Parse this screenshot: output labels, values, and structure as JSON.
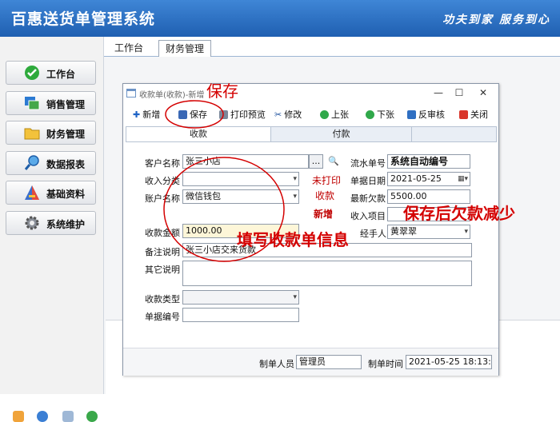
{
  "app": {
    "title": "百惠送货单管理系统",
    "slogan": "功夫到家 服务到心"
  },
  "sidebar": {
    "items": [
      {
        "label": "工作台",
        "icon": "check-circle-icon"
      },
      {
        "label": "销售管理",
        "icon": "window-stack-icon"
      },
      {
        "label": "财务管理",
        "icon": "folder-icon"
      },
      {
        "label": "数据报表",
        "icon": "magnifier-icon"
      },
      {
        "label": "基础资料",
        "icon": "pyramid-icon"
      },
      {
        "label": "系统维护",
        "icon": "gear-icon"
      }
    ]
  },
  "tabs": [
    {
      "label": "工作台"
    },
    {
      "label": "财务管理"
    }
  ],
  "dialog": {
    "title": "收款单(收款)-新增",
    "toolbar": {
      "new": "新增",
      "save": "保存",
      "print_preview": "打印预览",
      "edit": "修改",
      "prev": "上张",
      "next": "下张",
      "unaudit": "反审核",
      "close": "关闭"
    },
    "form_tabs": [
      "收款",
      "付款"
    ],
    "labels": {
      "customer": "客户名称",
      "income_type": "收入分类",
      "account": "账户名称",
      "amount": "收款金额",
      "remark": "备注说明",
      "other": "其它说明",
      "receipt_type": "收款类型",
      "doc_no": "单据编号",
      "serial": "流水单号",
      "date": "单据日期",
      "latest_debt": "最新欠款",
      "income_item": "收入项目",
      "handler": "经手人"
    },
    "values": {
      "customer": "张三小店",
      "account": "微信钱包",
      "amount": "1000.00",
      "remark": "张三小店交来货款",
      "serial": "系统自动编号",
      "date": "2021-05-25",
      "latest_debt": "5500.00",
      "handler": "黄翠翠",
      "lookup_btn": "..."
    },
    "status": {
      "print": "未打印",
      "mode": "收款",
      "state": "新增"
    },
    "footer": {
      "creator_label": "制单人员",
      "creator": "管理员",
      "time_label": "制单时间",
      "time": "2021-05-25 18:13:25"
    }
  },
  "annotations": {
    "save": "保存",
    "fill": "填写收款单信息",
    "debt": "保存后欠款减少"
  },
  "colors": {
    "header": "#2a6cc1",
    "annotation": "#d40000",
    "status_red": "#c00000"
  }
}
